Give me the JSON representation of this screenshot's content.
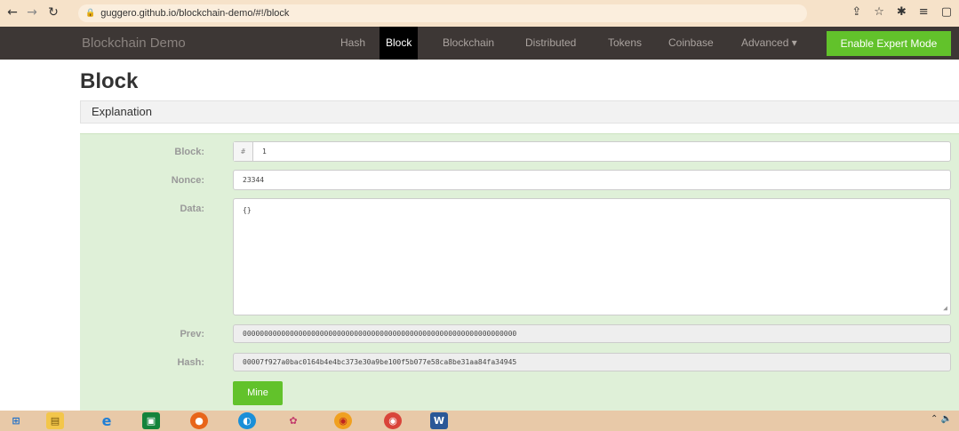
{
  "browser": {
    "url": "guggero.github.io/blockchain-demo/#!/block"
  },
  "navbar": {
    "brand": "Blockchain Demo",
    "items": [
      {
        "label": "Hash"
      },
      {
        "label": "Block"
      },
      {
        "label": "Blockchain"
      },
      {
        "label": "Distributed"
      },
      {
        "label": "Tokens"
      },
      {
        "label": "Coinbase"
      },
      {
        "label": "Advanced ▾"
      }
    ],
    "active": "Block",
    "expert_label": "Enable Expert Mode"
  },
  "page": {
    "title": "Block",
    "explanation": "Explanation"
  },
  "block": {
    "block_label": "Block:",
    "block_prefix": "#",
    "block_value": "1",
    "nonce_label": "Nonce:",
    "nonce_value": "23344",
    "data_label": "Data:",
    "data_value": "{}",
    "prev_label": "Prev:",
    "prev_value": "0000000000000000000000000000000000000000000000000000000000000000",
    "hash_label": "Hash:",
    "hash_value": "00007f927a0bac0164b4e4bc373e30a9be100f5b077e58ca8be31aa84fa34945",
    "mine_label": "Mine"
  },
  "colors": {
    "navbar_bg": "#3d3735",
    "accent_green": "#62c22b",
    "panel_green": "#dff0d8"
  },
  "taskbar": {
    "icons": [
      "windows-start-icon",
      "file-explorer-icon",
      "internet-explorer-icon",
      "store-icon",
      "firefox-icon",
      "edge-icon",
      "paint-icon",
      "chrome-icon",
      "chrome-profile-icon",
      "word-icon"
    ]
  }
}
